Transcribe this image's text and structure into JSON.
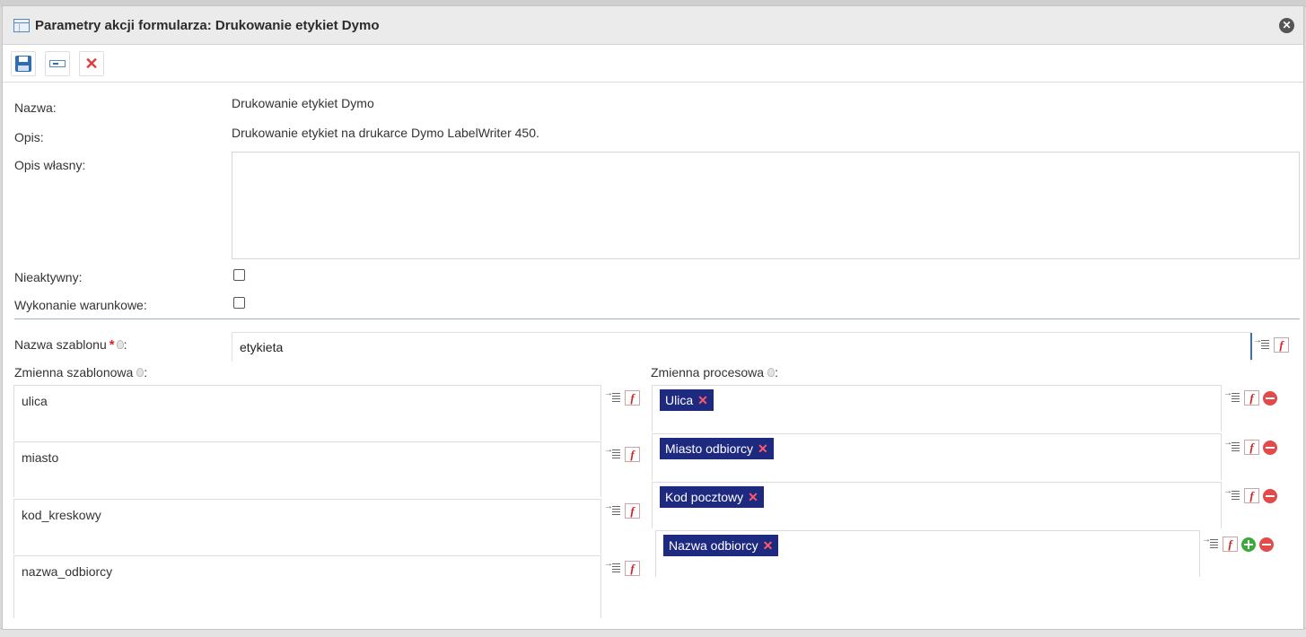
{
  "dialog": {
    "title": "Parametry akcji formularza: Drukowanie etykiet Dymo"
  },
  "icons": {
    "title": "form-table-icon",
    "close": "close-circle-icon",
    "save": "save-icon",
    "field": "field-icon",
    "cancel": "red-x-icon",
    "list": "variable-list-icon",
    "function": "function-icon",
    "remove": "minus-circle-icon",
    "add": "plus-circle-icon",
    "hint": "lightbulb-icon"
  },
  "form": {
    "name_label": "Nazwa:",
    "name_value": "Drukowanie etykiet Dymo",
    "desc_label": "Opis:",
    "desc_value": "Drukowanie etykiet na drukarce Dymo LabelWriter 450.",
    "own_desc_label": "Opis własny:",
    "own_desc_value": "",
    "inactive_label": "Nieaktywny:",
    "inactive_checked": false,
    "conditional_label": "Wykonanie warunkowe:",
    "conditional_checked": false,
    "template_name_label": "Nazwa szablonu",
    "required_mark": "*",
    "template_name_value": "etykieta"
  },
  "mapping": {
    "template_var_header": "Zmienna szablonowa",
    "process_var_header": "Zmienna procesowa",
    "colon": ":",
    "template_vars": [
      "ulica",
      "miasto",
      "kod_kreskowy",
      "nazwa_odbiorcy"
    ],
    "process_vars": [
      "Ulica",
      "Miasto odbiorcy",
      "Kod pocztowy",
      "Nazwa odbiorcy"
    ],
    "tag_remove": "✕"
  },
  "colors": {
    "tag_bg": "#1e2a80",
    "accent": "#3d6fb6",
    "remove": "#e24b4b",
    "add": "#3aab3a"
  }
}
